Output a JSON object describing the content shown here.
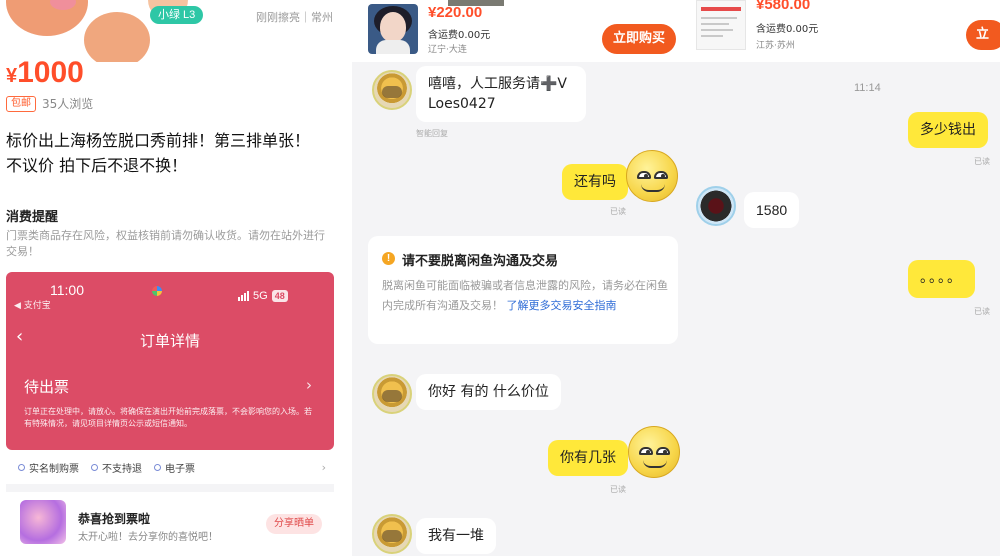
{
  "listing": {
    "level_badge": "小绿 L3",
    "hero_right": "刚刚擦亮｜常州",
    "price_currency": "¥",
    "price_value": "1000",
    "shipping_tag": "包邮",
    "views": "35人浏览",
    "description": "标价出上海杨笠脱口秀前排！第三排单张！\n不议价 拍下后不退不换！",
    "notice_title": "消费提醒",
    "notice_text": "门票类商品存在风险，权益核销前请勿确认收货。请勿在站外进行交易！",
    "order_screenshot": {
      "time": "11:00",
      "back_app": "◀ 支付宝",
      "network": "5G",
      "battery": "48",
      "page_title": "订单详情",
      "status": "待出票",
      "status_text": "订单正在处理中，请放心。将确保在演出开始前完成落票，不会影响您的入场。若有特殊情况，请见项目详情页公示或短信通知。",
      "features": [
        "实名制购票",
        "不支持退",
        "电子票"
      ]
    },
    "promo": {
      "title": "恭喜抢到票啦",
      "subtitle": "太开心啦！去分享你的喜悦吧！",
      "button": "分享晒单"
    }
  },
  "chat1": {
    "product": {
      "price": "¥220.00",
      "shipping": "含运费0.00元",
      "location": "辽宁·大连",
      "buy_button": "立即购买"
    },
    "messages": [
      {
        "side": "in",
        "text": "嘻嘻，人工服务请➕V\nLoes0427"
      },
      {
        "side": "out",
        "text": "还有吗"
      },
      {
        "side": "in",
        "text": "你好 有的 什么价位"
      },
      {
        "side": "out",
        "text": "你有几张"
      },
      {
        "side": "in",
        "text": "我有一堆"
      }
    ],
    "label_smart_reply": "智能回复",
    "label_read": "已读",
    "warning": {
      "icon": "!",
      "title": "请不要脱离闲鱼沟通及交易",
      "body": "脱离闲鱼可能面临被骗或者信息泄露的风险，请务必在闲鱼内完成所有沟通及交易！",
      "link": "了解更多交易安全指南"
    }
  },
  "chat2": {
    "product": {
      "price": "¥580.00",
      "shipping": "含运费0.00元",
      "location": "江苏·苏州",
      "buy_button": "立"
    },
    "timestamp": "11:14",
    "messages": [
      {
        "side": "out",
        "text": "多少钱出"
      },
      {
        "side": "in",
        "text": "1580"
      },
      {
        "side": "out",
        "text": "。。。。"
      }
    ],
    "label_read": "已读"
  }
}
